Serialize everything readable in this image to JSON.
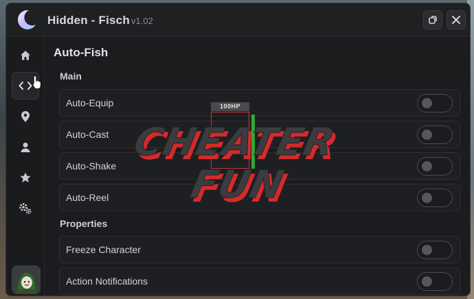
{
  "window": {
    "title": "Hidden - Fisch",
    "version": "v1.02",
    "restore_icon": "restore-icon",
    "close_icon": "close-icon"
  },
  "sidebar": {
    "items": [
      {
        "icon": "home-icon",
        "active": false
      },
      {
        "icon": "code-icon",
        "active": true
      },
      {
        "icon": "location-pin-icon",
        "active": false
      },
      {
        "icon": "user-icon",
        "active": false
      },
      {
        "icon": "star-icon",
        "active": false
      },
      {
        "icon": "gears-icon",
        "active": false
      }
    ]
  },
  "main": {
    "section_title": "Auto-Fish",
    "groups": [
      {
        "label": "Main",
        "toggles": [
          {
            "label": "Auto-Equip",
            "enabled": false
          },
          {
            "label": "Auto-Cast",
            "enabled": false
          },
          {
            "label": "Auto-Shake",
            "enabled": false
          },
          {
            "label": "Auto-Reel",
            "enabled": false
          }
        ]
      },
      {
        "label": "Properties",
        "toggles": [
          {
            "label": "Freeze Character",
            "enabled": false
          },
          {
            "label": "Action Notifications",
            "enabled": false
          }
        ]
      }
    ]
  },
  "overlay": {
    "hp_label": "100HP",
    "watermark_line1": "CHEATER",
    "watermark_line2": "FUN"
  },
  "colors": {
    "window_bg": "#1a1b1d",
    "row_bg": "#1e1f22",
    "text": "#d3d4d7",
    "health_bar": "#2fa832",
    "esp_box": "#c0393b",
    "watermark_shadow": "#d42a2a"
  }
}
